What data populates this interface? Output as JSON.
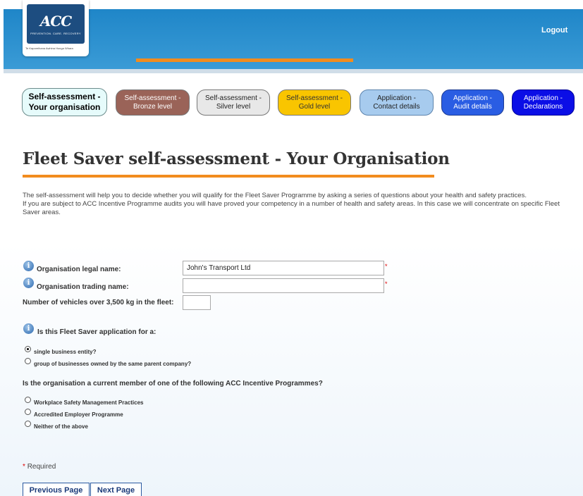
{
  "header": {
    "logo_mark": "ACC",
    "logo_sub": "PREVENTION. CARE. RECOVERY",
    "logo_tag": "Te Kaporeihana Awhina Hunga Whara",
    "logout_label": "Logout",
    "accent": "#f28c1e"
  },
  "steps": [
    {
      "line1": "Self-assessment -",
      "line2": "Your organisation",
      "color": "#e6fbfb"
    },
    {
      "line1": "Self-assessment -",
      "line2": "Bronze level",
      "color": "#9a6358"
    },
    {
      "line1": "Self-assessment -",
      "line2": "Silver level",
      "color": "#e8e8e8"
    },
    {
      "line1": "Self-assessment -",
      "line2": "Gold level",
      "color": "#f9c500"
    },
    {
      "line1": "Application -",
      "line2": "Contact details",
      "color": "#a7cbee"
    },
    {
      "line1": "Application -",
      "line2": "Audit details",
      "color": "#2a5de3"
    },
    {
      "line1": "Application -",
      "line2": "Declarations",
      "color": "#0b0ee6"
    }
  ],
  "page": {
    "title": "Fleet Saver self-assessment - Your Organisation",
    "intro_1": "The self-assessment will help you to decide whether you will qualify for the Fleet Saver Programme by asking a series of questions about your health and safety practices.",
    "intro_2": "If you are subject to ACC Incentive Programme audits you will have proved your competency in a number of health and safety areas. In this case we will concentrate on specific Fleet Saver areas."
  },
  "form": {
    "legal_name_label": "Organisation legal name:",
    "legal_name_value": "John's Transport Ltd",
    "trading_name_label": "Organisation trading name:",
    "trading_name_value": "",
    "vehicles_label": "Number of vehicles over 3,500 kg in the fleet:",
    "vehicles_value": "",
    "info_glyph": "i",
    "required_star": "*",
    "application_question": "Is this Fleet Saver application for a:",
    "application_options": [
      {
        "label": "single business entity?",
        "checked": true
      },
      {
        "label": "group of businesses owned by the same parent company?",
        "checked": false
      }
    ],
    "membership_question": "Is the organisation a current member of one of the following ACC Incentive Programmes?",
    "membership_options": [
      {
        "label": "Workplace Safety Management Practices",
        "checked": false
      },
      {
        "label": "Accredited Employer Programme",
        "checked": false
      },
      {
        "label": "Neither of the above",
        "checked": false
      }
    ],
    "required_note": "Required"
  },
  "buttons": {
    "previous": "Previous Page",
    "next": "Next Page"
  }
}
